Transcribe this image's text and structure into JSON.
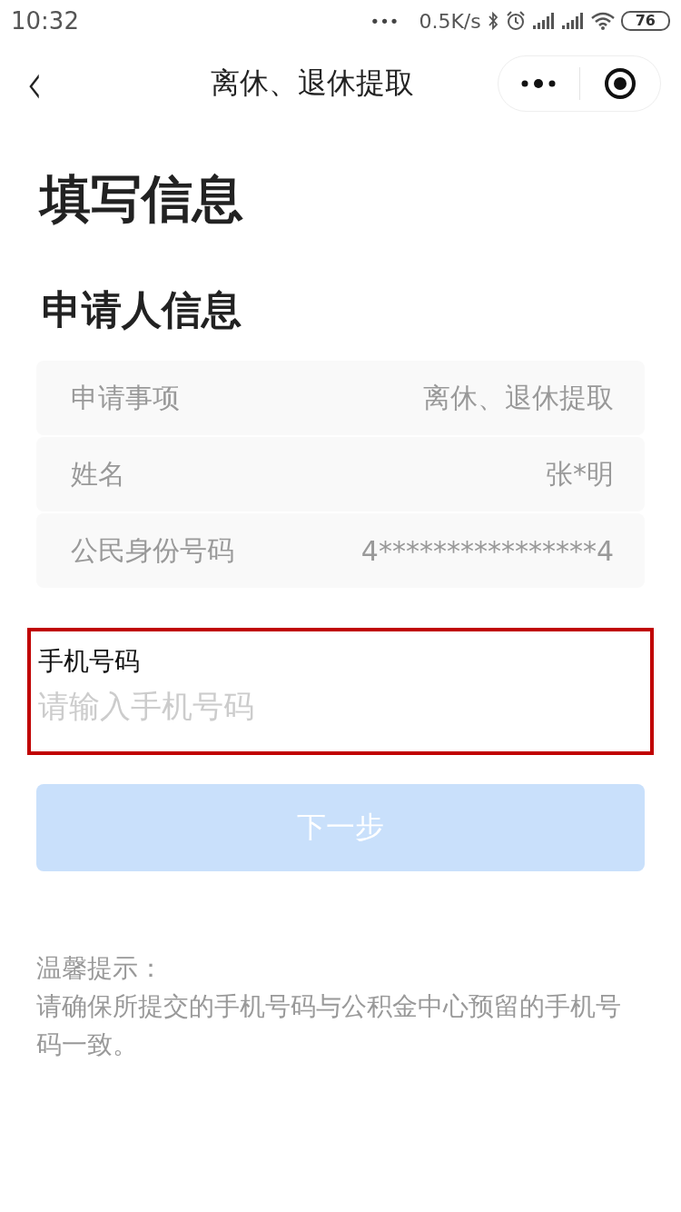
{
  "status_bar": {
    "time": "10:32",
    "more": "•••",
    "speed": "0.5K/s",
    "battery": "76"
  },
  "nav": {
    "back": "‹",
    "title": "离休、退休提取"
  },
  "heading": "填写信息",
  "section_title": "申请人信息",
  "info_rows": [
    {
      "label": "申请事项",
      "value": "离休、退休提取"
    },
    {
      "label": "姓名",
      "value": "张*明"
    },
    {
      "label": "公民身份号码",
      "value": "4****************4"
    }
  ],
  "phone_field": {
    "label": "手机号码",
    "placeholder": "请输入手机号码",
    "highlighted": true
  },
  "next_button": {
    "label": "下一步",
    "disabled": true
  },
  "tips": {
    "title": "温馨提示：",
    "text": "请确保所提交的手机号码与公积金中心预留的手机号码一致。"
  }
}
